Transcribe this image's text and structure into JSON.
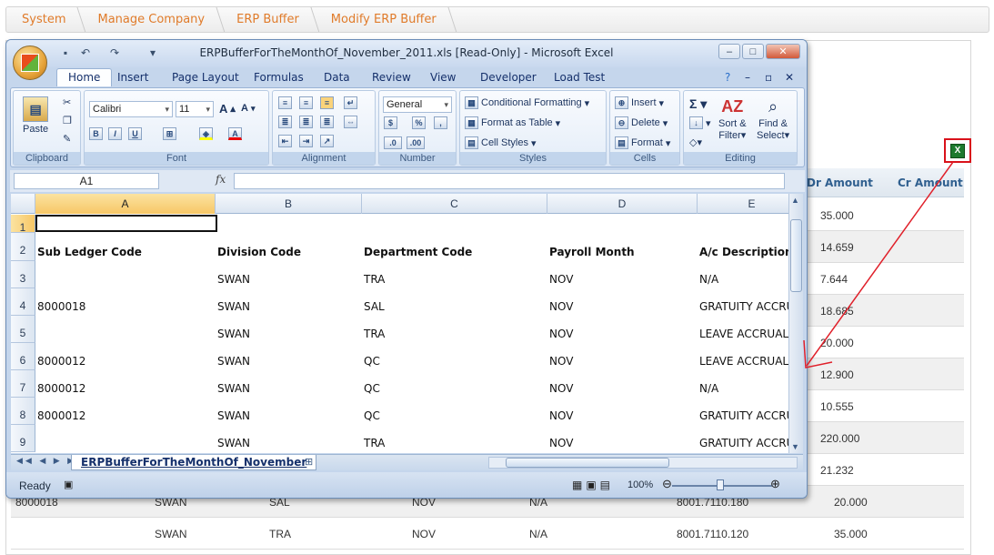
{
  "breadcrumb": [
    "System",
    "Manage Company",
    "ERP Buffer",
    "Modify ERP Buffer"
  ],
  "background_table": {
    "headers": [
      "Dr Amount",
      "Cr Amount"
    ],
    "dr_values": [
      "35.000",
      "14.659",
      "7.644",
      "18.685",
      "20.000",
      "12.900",
      "10.555",
      "220.000",
      "21.232"
    ],
    "bottom_rows": [
      {
        "code": "8000018",
        "division": "SWAN",
        "dept": "SAL",
        "month": "NOV",
        "desc": "N/A",
        "account": "8001.7110.180",
        "amount": "20.000"
      },
      {
        "code": "",
        "division": "SWAN",
        "dept": "TRA",
        "month": "NOV",
        "desc": "N/A",
        "account": "8001.7110.120",
        "amount": "35.000"
      }
    ]
  },
  "export_icon": "excel-export-icon",
  "excel": {
    "title": "ERPBufferForTheMonthOf_November_2011.xls  [Read-Only] - Microsoft Excel",
    "tabs": [
      "Home",
      "Insert",
      "Page Layout",
      "Formulas",
      "Data",
      "Review",
      "View",
      "Developer",
      "Load Test"
    ],
    "ribbon": {
      "clipboard": {
        "label": "Clipboard",
        "paste": "Paste"
      },
      "font": {
        "label": "Font",
        "name": "Calibri",
        "size": "11"
      },
      "alignment": {
        "label": "Alignment"
      },
      "number": {
        "label": "Number",
        "format": "General"
      },
      "styles": {
        "label": "Styles",
        "cond": "Conditional Formatting",
        "table": "Format as Table",
        "cell": "Cell Styles"
      },
      "cells": {
        "label": "Cells",
        "insert": "Insert",
        "delete": "Delete",
        "format": "Format"
      },
      "editing": {
        "label": "Editing",
        "sort": "Sort &",
        "sort2": "Filter",
        "find": "Find &",
        "find2": "Select"
      }
    },
    "name_box": "A1",
    "fx": "fx",
    "columns": [
      "A",
      "B",
      "C",
      "D",
      "E"
    ],
    "rows": [
      {
        "n": "1",
        "cells": [
          "",
          "",
          "",
          "",
          ""
        ]
      },
      {
        "n": "2",
        "cells": [
          "Sub Ledger Code",
          "Division Code",
          "Department Code",
          "Payroll Month",
          "A/c Description"
        ]
      },
      {
        "n": "3",
        "cells": [
          "",
          "SWAN",
          "TRA",
          "NOV",
          "N/A"
        ]
      },
      {
        "n": "4",
        "cells": [
          "8000018",
          "SWAN",
          "SAL",
          "NOV",
          "GRATUITY ACCRUAL"
        ]
      },
      {
        "n": "5",
        "cells": [
          "",
          "SWAN",
          "TRA",
          "NOV",
          "LEAVE ACCRUAL"
        ]
      },
      {
        "n": "6",
        "cells": [
          "8000012",
          "SWAN",
          "QC",
          "NOV",
          "LEAVE ACCRUAL"
        ]
      },
      {
        "n": "7",
        "cells": [
          "8000012",
          "SWAN",
          "QC",
          "NOV",
          "N/A"
        ]
      },
      {
        "n": "8",
        "cells": [
          "8000012",
          "SWAN",
          "QC",
          "NOV",
          "GRATUITY ACCRUAL"
        ]
      },
      {
        "n": "9",
        "cells": [
          "",
          "SWAN",
          "TRA",
          "NOV",
          "GRATUITY ACCRUAL"
        ]
      }
    ],
    "sheet_tab": "ERPBufferForTheMonthOf_November",
    "status": "Ready",
    "zoom": "100%"
  }
}
